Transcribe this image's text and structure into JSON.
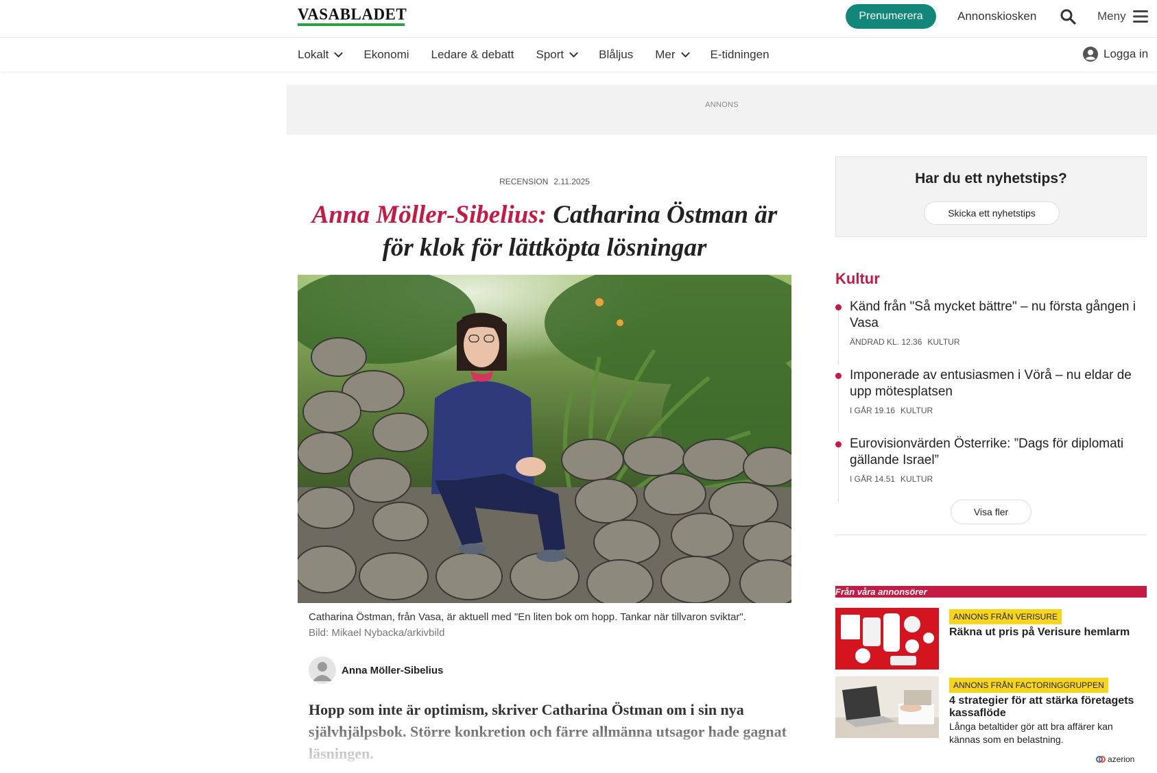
{
  "header": {
    "logo": "VASABLADET",
    "subscribe_label": "Prenumerera",
    "annons_label": "Annonskiosken",
    "menu_label": "Meny"
  },
  "nav": {
    "items": [
      {
        "label": "Lokalt",
        "dropdown": true
      },
      {
        "label": "Ekonomi",
        "dropdown": false
      },
      {
        "label": "Ledare & debatt",
        "dropdown": false
      },
      {
        "label": "Sport",
        "dropdown": true
      },
      {
        "label": "Blåljus",
        "dropdown": false
      },
      {
        "label": "Mer",
        "dropdown": true
      },
      {
        "label": "E-tidningen",
        "dropdown": false
      }
    ],
    "login_label": "Logga in"
  },
  "ad_banner": {
    "label": "ANNONS"
  },
  "article": {
    "category": "RECENSION",
    "date": "2.11.2025",
    "headline_author": "Anna Möller-Sibelius:",
    "headline_text": "Catharina Östman är för klok för lättköpta lösningar",
    "caption": "Catharina Östman, från Vasa, är aktuell med \"En liten bok om hopp. Tankar när tillvaron sviktar\".",
    "credit": "Bild: Mikael Nybacka/arkivbild",
    "byline": "Anna Möller-Sibelius",
    "lead": "Hopp som inte är optimism, skriver Catharina Östman om i sin nya självhjälpsbok. Större konkretion och färre allmänna utsagor hade gagnat läsningen."
  },
  "sidebar": {
    "tips": {
      "title": "Har du ett nyhetstips?",
      "button_label": "Skicka ett nyhetstips"
    },
    "kultur": {
      "title": "Kultur",
      "items": [
        {
          "headline": "Känd från \"Så mycket bättre\" – nu första gången i Vasa",
          "time": "ÄNDRAD KL. 12.36",
          "section": "KULTUR"
        },
        {
          "headline": "Imponerade av entusiasmen i Vörå – nu eldar de upp mötesplatsen",
          "time": "I GÅR 19.16",
          "section": "KULTUR"
        },
        {
          "headline": "Eurovisionvärden Österrike: ”Dags för diplomati gällande Israel”",
          "time": "I GÅR 14.51",
          "section": "KULTUR"
        }
      ],
      "more_label": "Visa fler"
    },
    "advertisers": {
      "header": "Från våra annonsörer",
      "items": [
        {
          "label": "ANNONS FRÅN VERISURE",
          "title": "Räkna ut pris på Verisure hemlarm",
          "text": ""
        },
        {
          "label": "ANNONS FRÅN FACTORINGGRUPPEN",
          "title": "4 strategier för att stärka företagets kassaflöde",
          "text": "Långa betaltider gör att bra affärer kan kännas som en belastning."
        }
      ],
      "network_label": "azerion"
    }
  },
  "colors": {
    "accent_red": "#c41a44",
    "subscribe_teal": "#11877a",
    "logo_green": "#2f9e44",
    "ad_label_yellow": "#f7d51c"
  }
}
